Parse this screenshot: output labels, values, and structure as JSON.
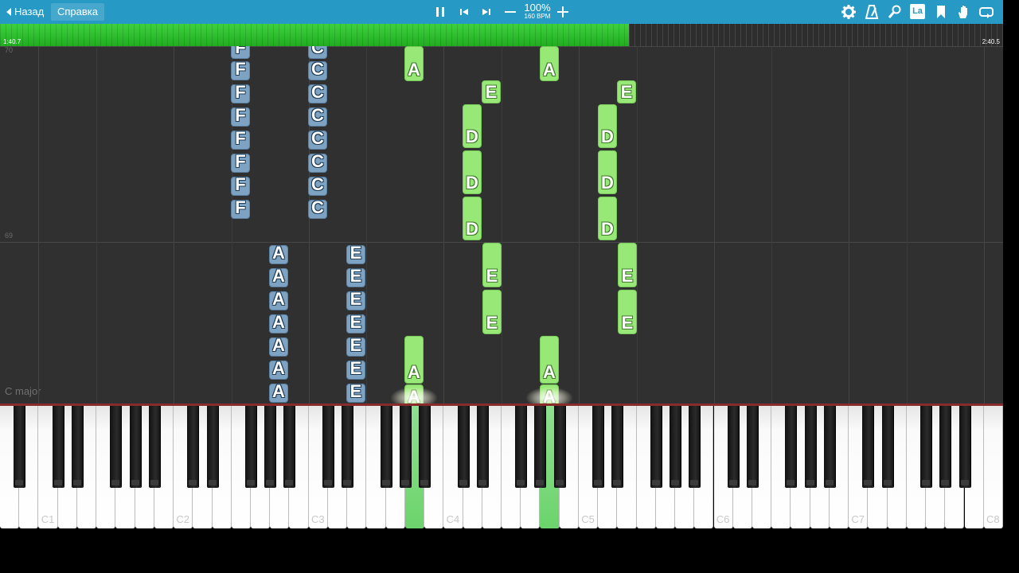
{
  "toolbar": {
    "back_label": "Назад",
    "help_label": "Справка",
    "tempo_percent": "100%",
    "tempo_bpm": "160 BPM",
    "icons": [
      "pause-icon",
      "skip-back-icon",
      "skip-forward-icon",
      "minus-icon",
      "plus-icon",
      "gear-icon",
      "metronome-icon",
      "key-icon",
      "la-label-icon",
      "bookmark-icon",
      "hand-icon",
      "loop-icon"
    ],
    "la_text": "La"
  },
  "progress": {
    "start_time": "1:40.7",
    "end_time": "2:40.5",
    "fraction": 0.627
  },
  "roll": {
    "measure_top": "70",
    "measure_mid": "69",
    "key_signature": "C major"
  },
  "notes": [
    {
      "letter": "F",
      "color": "blue",
      "count": 8
    },
    {
      "letter": "C",
      "color": "blue",
      "count": 8
    },
    {
      "letter": "A",
      "color": "blue",
      "count": 7
    },
    {
      "letter": "E",
      "color": "blue",
      "count": 7
    },
    {
      "letter": "A",
      "color": "green"
    },
    {
      "letter": "E",
      "color": "green"
    },
    {
      "letter": "D",
      "color": "green",
      "count": 3
    },
    {
      "letter": "E",
      "color": "green",
      "count": 2
    },
    {
      "letter": "A",
      "color": "green"
    }
  ],
  "keyboard": {
    "octave_labels": [
      "C1",
      "C2",
      "C3",
      "C4",
      "C5",
      "C6",
      "C7",
      "C8"
    ],
    "pressed_keys": [
      "A3",
      "A4"
    ],
    "colors": {
      "pressed": "#6cd46c",
      "left_hand": "#7ea3c2",
      "right_hand": "#98e878",
      "toolbar": "#2699c4",
      "progress": "#22b022"
    }
  }
}
